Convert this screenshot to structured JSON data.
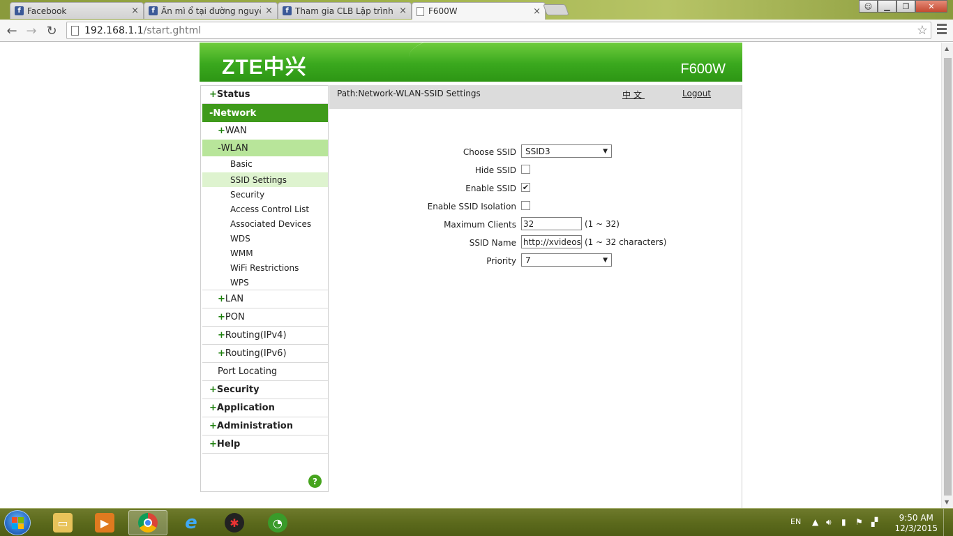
{
  "browser": {
    "tabs": [
      {
        "label": "Facebook",
        "icon": "facebook-icon",
        "active": false
      },
      {
        "label": "Ẩn mì ổ tại đường nguyễn",
        "icon": "facebook-icon",
        "active": false
      },
      {
        "label": "Tham gia CLB Lập trình",
        "icon": "facebook-icon",
        "active": false
      },
      {
        "label": "F600W",
        "icon": "page-icon",
        "active": true
      }
    ],
    "close_glyph": "×",
    "url_host": "192.168.1.1",
    "url_path": "/start.ghtml"
  },
  "banner": {
    "logo": "ZTE中兴",
    "model": "F600W"
  },
  "sidebar": {
    "status": "Status",
    "network": "Network",
    "wan": "WAN",
    "wlan": "WLAN",
    "wlan_items": [
      {
        "label": "Basic",
        "active": false
      },
      {
        "label": "SSID Settings",
        "active": true
      },
      {
        "label": "Security",
        "active": false
      },
      {
        "label": "Access Control List",
        "active": false
      },
      {
        "label": "Associated Devices",
        "active": false
      },
      {
        "label": "WDS",
        "active": false
      },
      {
        "label": "WMM",
        "active": false
      },
      {
        "label": "WiFi Restrictions",
        "active": false
      },
      {
        "label": "WPS",
        "active": false
      }
    ],
    "lan": "LAN",
    "pon": "PON",
    "routing_v4": "Routing(IPv4)",
    "routing_v6": "Routing(IPv6)",
    "port_locating": "Port Locating",
    "security": "Security",
    "application": "Application",
    "administration": "Administration",
    "help": "Help",
    "plus": "+",
    "minus": "-",
    "help_icon": "?"
  },
  "content": {
    "path": "Path:Network-WLAN-SSID Settings",
    "language": "中文",
    "logout": "Logout",
    "fields": {
      "choose_ssid": {
        "label": "Choose SSID",
        "value": "SSID3"
      },
      "hide_ssid": {
        "label": "Hide SSID",
        "checked": false
      },
      "enable_ssid": {
        "label": "Enable SSID",
        "checked": true
      },
      "enable_isolation": {
        "label": "Enable SSID Isolation",
        "checked": false
      },
      "max_clients": {
        "label": "Maximum Clients",
        "value": "32",
        "hint": "(1 ~ 32)"
      },
      "ssid_name": {
        "label": "SSID Name",
        "value": "http://xvideos",
        "hint": "(1 ~ 32 characters)"
      },
      "priority": {
        "label": "Priority",
        "value": "7"
      }
    },
    "check_glyph": "✔",
    "dropdown_glyph": "▼"
  },
  "taskbar": {
    "language": "EN",
    "time": "9:50 AM",
    "date": "12/3/2015",
    "apps": [
      "explorer-icon",
      "media-player-icon",
      "chrome-icon",
      "internet-explorer-icon",
      "zoom-app-icon",
      "coccoc-icon"
    ]
  },
  "colors": {
    "brand_green": "#3aa81e",
    "menu_active": "#3f9a1b",
    "submenu_active": "#b8e59a",
    "leaf_active": "#def3cf",
    "path_bar": "#dcdcdc"
  }
}
